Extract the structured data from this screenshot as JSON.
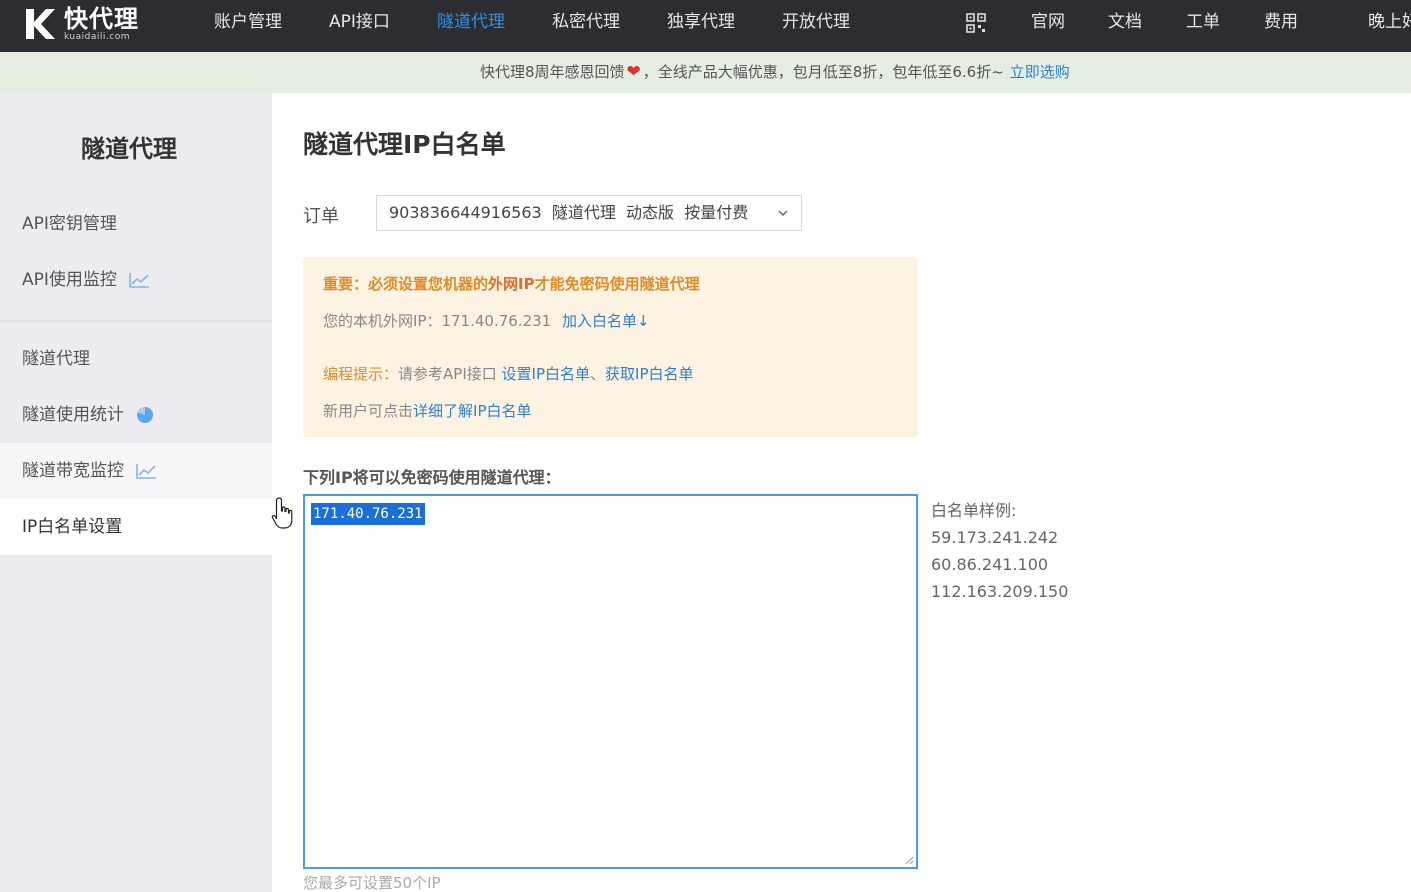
{
  "brand": {
    "title": "快代理",
    "sub": "kuaidaili.com"
  },
  "nav": {
    "items": [
      "账户管理",
      "API接口",
      "隧道代理",
      "私密代理",
      "独享代理",
      "开放代理"
    ],
    "active_index": 2,
    "right_items": [
      "官网",
      "文档",
      "工单",
      "费用",
      "晚上好"
    ],
    "qr_icon": "qr-code-icon"
  },
  "promo": {
    "text_before": "快代理8周年感恩回馈",
    "heart": "❤",
    "text_after": "，全线产品大幅优惠，包月低至8折，包年低至6.6折~",
    "link": "立即选购"
  },
  "sidebar": {
    "title": "隧道代理",
    "items": [
      {
        "label": "API密钥管理",
        "icon": ""
      },
      {
        "label": "API使用监控",
        "icon": "line-chart-icon"
      },
      {
        "label": "隧道代理",
        "icon": ""
      },
      {
        "label": "隧道使用统计",
        "icon": "pie-chart-icon"
      },
      {
        "label": "隧道带宽监控",
        "icon": "line-chart-icon"
      },
      {
        "label": "IP白名单设置",
        "icon": ""
      }
    ],
    "hover_index": 4,
    "active_index": 5
  },
  "main": {
    "title": "隧道代理IP白名单",
    "order_label": "订单",
    "order_value": "903836644916563  隧道代理  动态版  按量付费",
    "notice": {
      "important_prefix": "重要：必须设置您机器的",
      "important_highlight": "外网IP",
      "important_suffix": "才能免密码使用隧道代理",
      "local_ip_label": "您的本机外网IP：171.40.76.231",
      "add_link": "加入白名单↓",
      "tip_label": "编程提示：",
      "tip_text": "请参考API接口",
      "tip_link1": "设置IP白名单",
      "tip_sep": "、",
      "tip_link2": "获取IP白名单",
      "newuser_text": "新用户可点击",
      "newuser_link": "详细了解IP白名单"
    },
    "list_label": "下列IP将可以免密码使用隧道代理：",
    "ip_list_value": "171.40.76.231",
    "max_hint": "您最多可设置50个IP",
    "sample": {
      "title": "白名单样例:",
      "ips": [
        "59.173.241.242",
        "60.86.241.100",
        "112.163.209.150"
      ]
    }
  },
  "colors": {
    "nav_bg": "#2b2d30",
    "accent": "#2f8fe6",
    "promo_bg": "#e4efe1",
    "notice_bg": "#fdf3e2",
    "notice_orange": "#e08b2a",
    "sidebar_bg": "#ececf1"
  }
}
